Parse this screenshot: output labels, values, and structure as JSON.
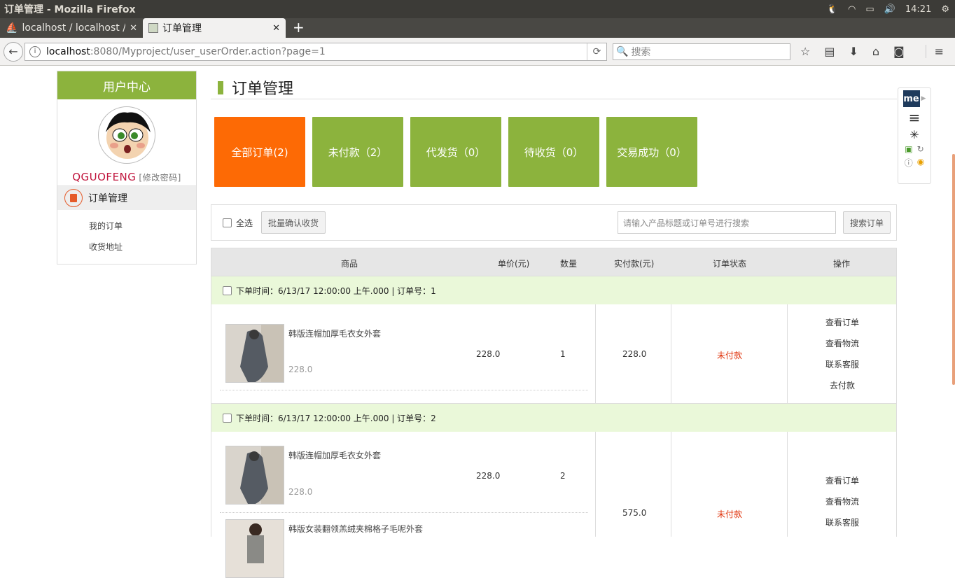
{
  "window": {
    "title": "订单管理 - Mozilla Firefox",
    "clock": "14:21"
  },
  "tabs": [
    {
      "label": "localhost / localhost /",
      "active": false
    },
    {
      "label": "订单管理",
      "active": true
    }
  ],
  "url": {
    "host": "localhost",
    "path": ":8080/Myproject/user_userOrder.action?page=1"
  },
  "search": {
    "placeholder": "搜索"
  },
  "sidebar": {
    "header": "用户中心",
    "username": "QGUOFENG",
    "change_password": "[修改密码]",
    "section": "订单管理",
    "links": [
      "我的订单",
      "收货地址"
    ]
  },
  "page": {
    "title": "订单管理"
  },
  "status_tabs": [
    "全部订单(2)",
    "未付款（2）",
    "代发货（0）",
    "待收货（0）",
    "交易成功（0）"
  ],
  "toolbar": {
    "select_all": "全选",
    "batch_confirm": "批量确认收货",
    "search_placeholder": "请输入产品标题或订单号进行搜索",
    "search_button": "搜索订单"
  },
  "table": {
    "headers": [
      "商品",
      "单价(元)",
      "数量",
      "实付款(元)",
      "订单状态",
      "操作"
    ]
  },
  "orders": [
    {
      "header": "下单时间：6/13/17 12:00:00 上午.000 | 订单号：1",
      "items": [
        {
          "name": "韩版连帽加厚毛衣女外套",
          "price": "228.0",
          "unit_price": "228.0",
          "qty": "1"
        }
      ],
      "total": "228.0",
      "status": "未付款",
      "actions": [
        "查看订单",
        "查看物流",
        "联系客服",
        "去付款"
      ]
    },
    {
      "header": "下单时间：6/13/17 12:00:00 上午.000 | 订单号：2",
      "items": [
        {
          "name": "韩版连帽加厚毛衣女外套",
          "price": "228.0",
          "unit_price": "228.0",
          "qty": "2"
        },
        {
          "name": "韩版女装翻领羔绒夹棉格子毛呢外套"
        }
      ],
      "total": "575.0",
      "status": "未付款",
      "actions": [
        "查看订单",
        "查看物流",
        "联系客服"
      ]
    }
  ],
  "colors": {
    "accent_green": "#8cb33d",
    "active_orange": "#fd6a05",
    "status_red": "#e0340c",
    "order_row_bg": "#eaf8d9"
  },
  "icons": [
    "firefox-icon",
    "back-arrow-icon",
    "info-icon",
    "reload-icon",
    "search-icon",
    "bookmark-star-icon",
    "reader-icon",
    "download-icon",
    "home-icon",
    "pocket-icon",
    "hamburger-menu-icon",
    "me-extension-icon",
    "wand-icon"
  ]
}
